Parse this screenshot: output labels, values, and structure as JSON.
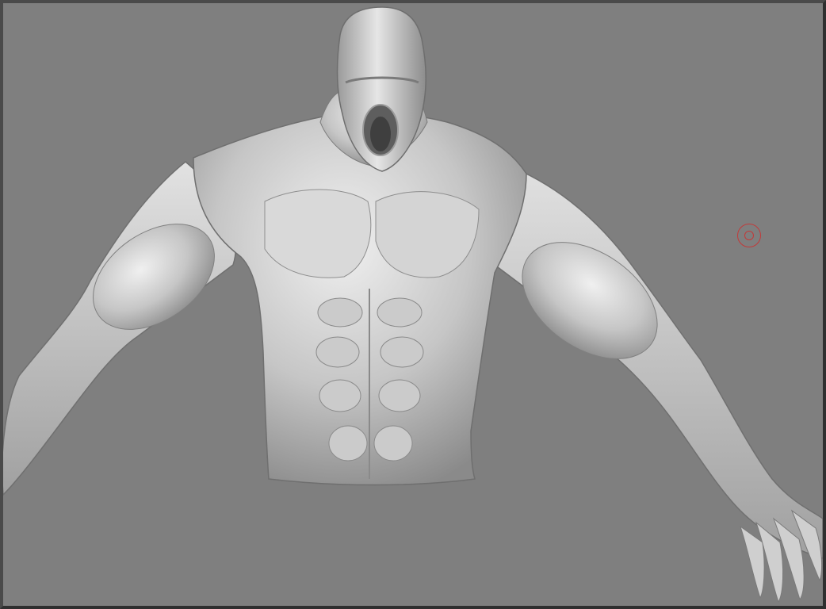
{
  "viewport": {
    "background_color": "#7f7f7f",
    "frame_color": "#4a4a4a"
  },
  "model": {
    "icon": "sculpted-torso-model",
    "material_color": "#c8c8c8",
    "shadow_color": "#6a6a6a",
    "highlight_color": "#f2f2f2"
  },
  "brush": {
    "icon": "brush-cursor-icon",
    "color": "#c23a3a"
  }
}
